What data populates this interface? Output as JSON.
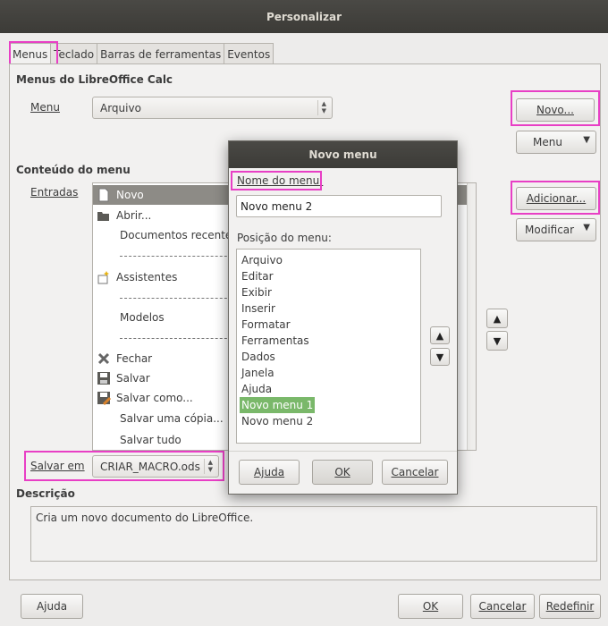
{
  "window": {
    "title": "Personalizar"
  },
  "tabs": [
    "Menus",
    "Teclado",
    "Barras de ferramentas",
    "Eventos"
  ],
  "section": {
    "menus_heading": "Menus do LibreOffice Calc",
    "menu_label": "Menu",
    "menu_value": "Arquivo",
    "new_button": "Novo...",
    "menu_button": "Menu",
    "content_heading": "Conteúdo do menu",
    "entries_label": "Entradas",
    "add_button": "Adicionar...",
    "modify_button": "Modificar",
    "save_in_label": "Salvar em",
    "save_in_value": "CRIAR_MACRO.ods",
    "description_heading": "Descrição",
    "description_text": "Cria um novo documento do LibreOffice."
  },
  "entries": [
    {
      "type": "item",
      "label": "Novo",
      "icon": "new-document-icon",
      "selected": true
    },
    {
      "type": "item",
      "label": "Abrir...",
      "icon": "open-folder-icon"
    },
    {
      "type": "item",
      "label": "Documentos recentes",
      "icon": ""
    },
    {
      "type": "separator",
      "label": ""
    },
    {
      "type": "item",
      "label": "Assistentes",
      "icon": "wizard-icon"
    },
    {
      "type": "separator",
      "label": ""
    },
    {
      "type": "item",
      "label": "Modelos",
      "icon": ""
    },
    {
      "type": "separator",
      "label": ""
    },
    {
      "type": "item",
      "label": "Fechar",
      "icon": "close-icon"
    },
    {
      "type": "item",
      "label": "Salvar",
      "icon": "save-icon"
    },
    {
      "type": "item",
      "label": "Salvar como...",
      "icon": "save-as-icon"
    },
    {
      "type": "item",
      "label": "Salvar uma cópia...",
      "icon": ""
    },
    {
      "type": "item",
      "label": "Salvar tudo",
      "icon": ""
    }
  ],
  "footer": {
    "help": "Ajuda",
    "ok": "OK",
    "cancel": "Cancelar",
    "reset": "Redefinir"
  },
  "dialog": {
    "title": "Novo menu",
    "name_label": "Nome do menu:",
    "name_value": "Novo menu 2",
    "position_label": "Posição do menu:",
    "positions": [
      "Arquivo",
      "Editar",
      "Exibir",
      "Inserir",
      "Formatar",
      "Ferramentas",
      "Dados",
      "Janela",
      "Ajuda",
      "Novo menu 1",
      "Novo menu 2"
    ],
    "selected_position": "Novo menu 1",
    "help": "Ajuda",
    "ok": "OK",
    "cancel": "Cancelar"
  },
  "colors": {
    "highlight": "#e83fc5",
    "list_selection": "#8d8b86",
    "dialog_selection": "#7ab86a",
    "titlebar": "#3c3b37"
  }
}
